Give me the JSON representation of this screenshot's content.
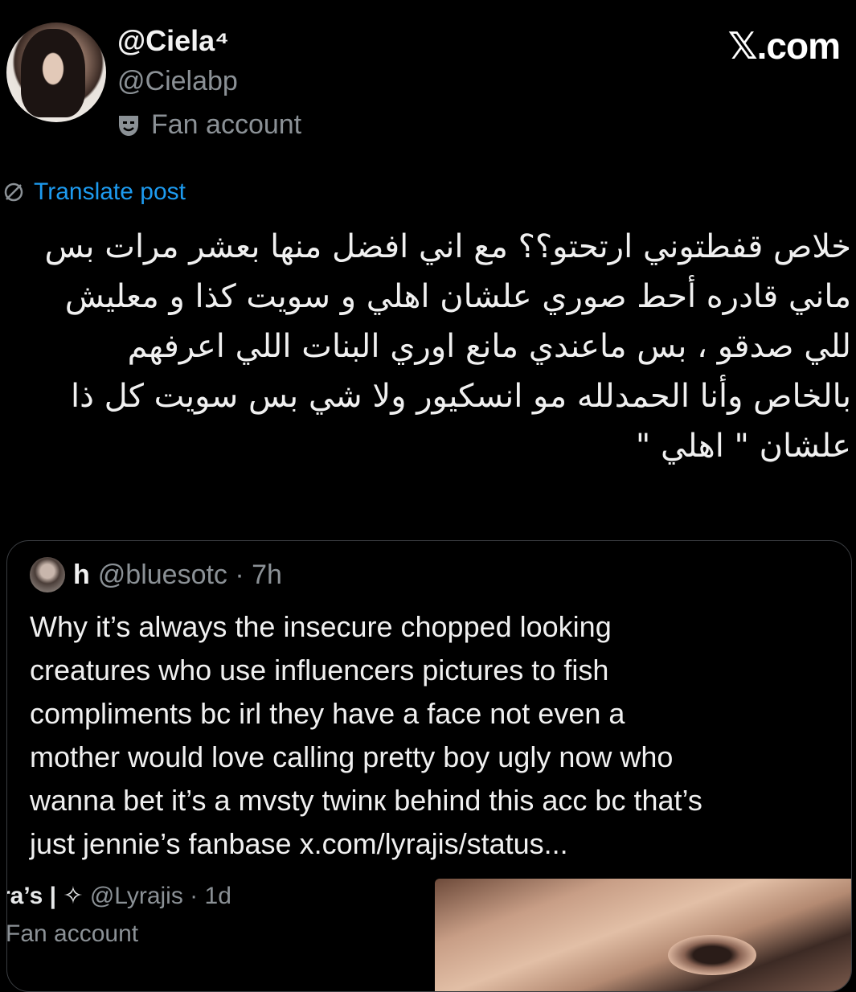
{
  "header": {
    "display_name": "@Ciela⁴",
    "handle": "@Cielabp",
    "account_label": "Fan account",
    "brand": "𝕏.com"
  },
  "post": {
    "translate_label": "Translate post",
    "text_lines": [
      "خلاص قفطتوني ارتحتو؟؟ مع اني افضل منها بعشر مرات بس",
      "ماني قادره أحط صوري علشان اهلي و سويت كذا و معليش",
      "للي صدقو ، بس ماعندي مانع اوري البنات اللي اعرفهم",
      "بالخاص وأنا الحمدلله مو انسكيور ولا شي بس سويت كل ذا",
      "علشان \" اهلي \""
    ]
  },
  "quoted": {
    "name": "h",
    "handle_time": "@bluesotc · 7h",
    "text_lines": [
      "Why it’s always the insecure chopped looking",
      "creatures who use influencers pictures to fish",
      "compliments bc irl they have a face not even a",
      "mother would love calling pretty boy ugly now who",
      "wanna bet it’s a mvsty twinк behind this acc bc that’s",
      "just jennie’s fanbase x.com/lyrajis/status..."
    ],
    "inner": {
      "name": "ra’s | ✧",
      "meta": "@Lyrajis · 1d",
      "account_label": "Fan account"
    }
  }
}
